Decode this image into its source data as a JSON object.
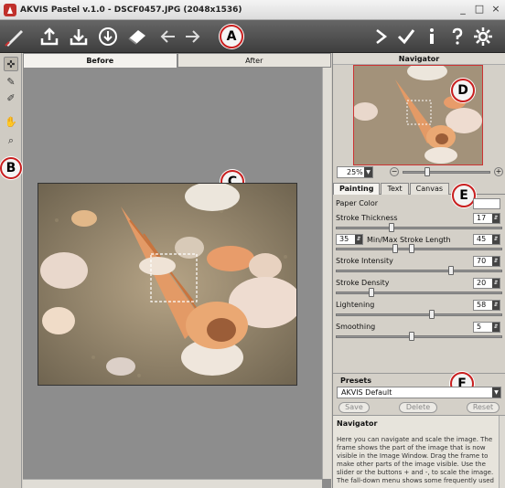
{
  "window": {
    "title": "AKVIS Pastel v.1.0 - DSCF0457.JPG (2048x1536)",
    "controls": [
      "_",
      "□",
      "×"
    ]
  },
  "callouts": {
    "a": "A",
    "b": "B",
    "c": "C",
    "d": "D",
    "e": "E",
    "f": "F"
  },
  "view_tabs": [
    "Before",
    "After"
  ],
  "navigator": {
    "title": "Navigator",
    "zoom": "25%"
  },
  "param_tabs": [
    "Painting",
    "Text",
    "Canvas"
  ],
  "params": {
    "paper_color": "Paper Color",
    "stroke_thickness": {
      "label": "Stroke Thickness",
      "value": "17",
      "level": 0.33
    },
    "stroke_length": {
      "label": "Min/Max Stroke Length",
      "min": "35",
      "max": "45",
      "level_min": 0.35,
      "level_max": 0.45
    },
    "stroke_intensity": {
      "label": "Stroke Intensity",
      "value": "70",
      "level": 0.7
    },
    "stroke_density": {
      "label": "Stroke Density",
      "value": "20",
      "level": 0.2
    },
    "lightening": {
      "label": "Lightening",
      "value": "58",
      "level": 0.58
    },
    "smoothing": {
      "label": "Smoothing",
      "value": "5",
      "level": 0.5
    }
  },
  "presets": {
    "title": "Presets",
    "selected": "AKVIS Default",
    "save": "Save",
    "delete": "Delete",
    "reset": "Reset"
  },
  "help": {
    "title": "Navigator",
    "text": "Here you can navigate and scale the image. The frame shows the part of the image that is now visible in the Image Window. Drag the frame to make other parts of the image visible. Use the slider or the buttons + and -, to scale the image. The fall-down menu shows some frequently used"
  },
  "colors": {
    "accent": "#c81e1e",
    "toolbar": "#4a4a4a"
  }
}
